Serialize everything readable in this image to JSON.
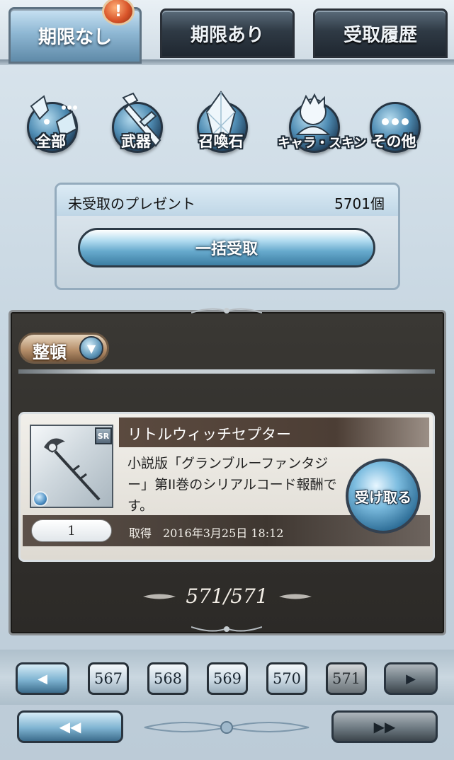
{
  "tabs": [
    {
      "label": "期限なし",
      "active": true
    },
    {
      "label": "期限あり",
      "active": false
    },
    {
      "label": "受取履歴",
      "active": false
    }
  ],
  "badge_glyph": "!",
  "categories": [
    {
      "label": "全部",
      "icon": "all-items-icon"
    },
    {
      "label": "武器",
      "icon": "sword-icon"
    },
    {
      "label": "召喚石",
      "icon": "summon-stone-icon"
    },
    {
      "label": "キャラ・スキン",
      "icon": "character-icon"
    },
    {
      "label": "その他",
      "icon": "more-icon"
    }
  ],
  "present": {
    "label": "未受取のプレゼント",
    "count": "5701個",
    "bulk_receive_label": "一括受取"
  },
  "sort": {
    "label": "整頓"
  },
  "item": {
    "rarity": "SR",
    "name": "リトルウィッチセプター",
    "description": "小説版「グランブルーファンタジー」第II巻のシリアルコード報酬です。",
    "receive_label": "受け取る",
    "quantity": "1",
    "acquired": "取得　2016年3月25日 18:12"
  },
  "page_counter": "571/571",
  "pagination": {
    "pages": [
      "567",
      "568",
      "569",
      "570",
      "571"
    ],
    "current": "571",
    "prev_glyph": "◀",
    "next_glyph": "▶",
    "first_glyph": "◀◀",
    "last_glyph": "▶▶"
  },
  "colors": {
    "accent_blue": "#5f8aa8",
    "dark_panel": "#2c2a27",
    "sort_brown": "#b8916c"
  }
}
